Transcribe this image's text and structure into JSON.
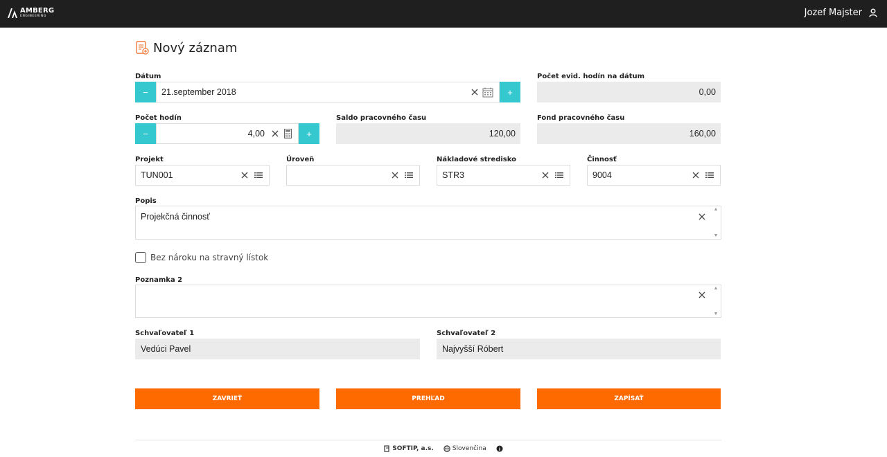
{
  "header": {
    "brand": "AMBERG",
    "brand_sub": "ENGINEERING",
    "user_name": "Jozef Majster"
  },
  "page": {
    "title": "Nový záznam"
  },
  "form": {
    "datum": {
      "label": "Dátum",
      "value": "21.september 2018"
    },
    "pocet_evid": {
      "label": "Počet evid. hodín na dátum",
      "value": "0,00"
    },
    "pocet_hodin": {
      "label": "Počet hodín",
      "value": "4,00"
    },
    "saldo": {
      "label": "Saldo pracovného času",
      "value": "120,00"
    },
    "fond": {
      "label": "Fond pracovného času",
      "value": "160,00"
    },
    "projekt": {
      "label": "Projekt",
      "value": "TUN001"
    },
    "uroven": {
      "label": "Úroveň",
      "value": ""
    },
    "nakladove": {
      "label": "Nákladové stredisko",
      "value": "STR3"
    },
    "cinnost": {
      "label": "Činnosť",
      "value": "9004"
    },
    "popis": {
      "label": "Popis",
      "value": "Projekčná činnosť"
    },
    "bez_naroku": {
      "label": "Bez nároku na stravný lístok",
      "checked": false
    },
    "poznamka2": {
      "label": "Poznamka 2",
      "value": ""
    },
    "schvalovatel1": {
      "label": "Schvaľovateľ 1",
      "value": "Vedúci Pavel"
    },
    "schvalovatel2": {
      "label": "Schvaľovateľ 2",
      "value": "Najvyšší Róbert"
    },
    "minus_symbol": "−",
    "plus_symbol": "+"
  },
  "buttons": {
    "zavriet": "ZAVRIEŤ",
    "prehlad": "PREHĽAD",
    "zapisat": "ZAPÍSAŤ"
  },
  "footer": {
    "company": "SOFTIP, a.s.",
    "language": "Slovenčina"
  },
  "colors": {
    "accent_teal": "#36c8cf",
    "accent_orange": "#ff6a00",
    "topbar": "#1f1f1f"
  }
}
